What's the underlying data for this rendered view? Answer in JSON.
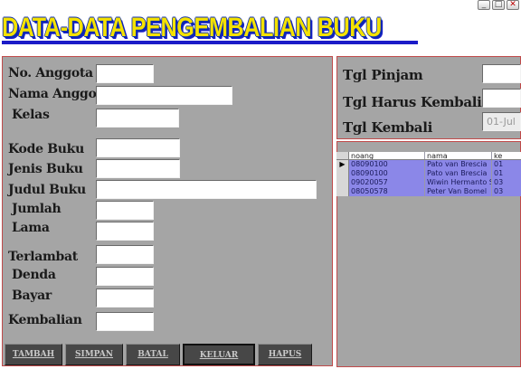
{
  "title": "DATA-DATA PENGEMBALIAN BUKU",
  "window_controls": {
    "minimize": "_",
    "maximize": "□",
    "close": "✕"
  },
  "left_labels": {
    "no_anggota": "No. Anggota",
    "nama_anggota": "Nama Anggota",
    "kelas": "Kelas",
    "kode_buku": "Kode Buku",
    "jenis_buku": "Jenis Buku",
    "judul_buku": "Judul Buku",
    "jumlah": "Jumlah",
    "lama": "Lama",
    "terlambat": "Terlambat",
    "denda": "Denda",
    "bayar": "Bayar",
    "kembalian": "Kembalian"
  },
  "right_labels": {
    "tgl_pinjam": "Tgl Pinjam",
    "tgl_harus_kembali": "Tgl Harus Kembali",
    "tgl_kembali": "Tgl Kembali"
  },
  "fields": {
    "no_anggota": "",
    "nama_anggota": "",
    "kelas": "",
    "kode_buku": "",
    "jenis_buku": "",
    "judul_buku": "",
    "jumlah": "",
    "lama": "",
    "terlambat": "",
    "denda": "",
    "bayar": "",
    "kembalian": "",
    "tgl_pinjam": "",
    "tgl_harus_kembali": "",
    "tgl_kembali": "01-Jul"
  },
  "buttons": {
    "tambah": "TAMBAH",
    "simpan": "SIMPAN",
    "batal": "BATAL",
    "keluar": "KELUAR",
    "hapus": "HAPUS"
  },
  "grid": {
    "columns": [
      "noang",
      "nama",
      "ke"
    ],
    "rows": [
      [
        "08090100",
        "Pato van Brescia",
        "01"
      ],
      [
        "08090100",
        "Pato van Brescia",
        "01"
      ],
      [
        "09020057",
        "Wiwin Hermanto S",
        "03"
      ],
      [
        "08050578",
        "Peter Van Bomel",
        "03"
      ]
    ]
  },
  "colors": {
    "title_yellow": "#f4e200",
    "title_blue": "#0b2ab0",
    "panel_gray": "#a5a5a5",
    "panel_border": "#c04a4a",
    "grid_row": "#8b87e8",
    "button_dark": "#474747"
  }
}
